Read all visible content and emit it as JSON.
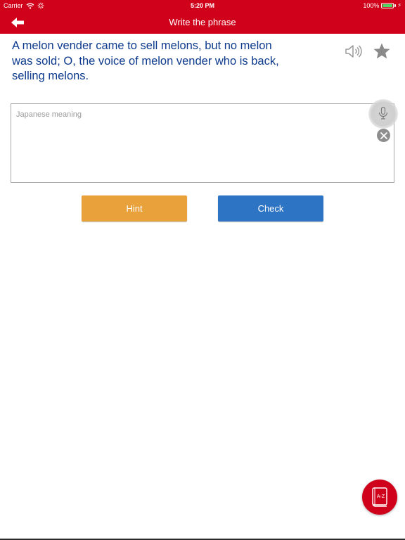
{
  "status_bar": {
    "carrier": "Carrier",
    "time": "5:20 PM",
    "battery": "100%",
    "battery_level": 1.0,
    "icons": [
      "wifi-icon",
      "battery-icon",
      "charging-bolt-icon"
    ]
  },
  "nav": {
    "title": "Write the phrase",
    "back_icon": "arrow-left-icon"
  },
  "phrase": {
    "text": "A melon vender came to sell melons, but no melon was sold; O, the voice of melon vender who is back, selling melons.",
    "color": "#0d3a8c"
  },
  "answer": {
    "placeholder": "Japanese meaning",
    "value": ""
  },
  "buttons": {
    "hint": "Hint",
    "check": "Check"
  },
  "icons": {
    "speaker": "speaker-icon",
    "star": "star-icon",
    "mic": "microphone-icon",
    "clear": "clear-icon",
    "dictionary": "dictionary-az-icon"
  },
  "dictionary": {
    "label": "A-Z"
  },
  "colors": {
    "brand": "#d0021b",
    "hint": "#e9a23b",
    "check": "#2e74c4",
    "battery_fill": "#4cd964"
  }
}
